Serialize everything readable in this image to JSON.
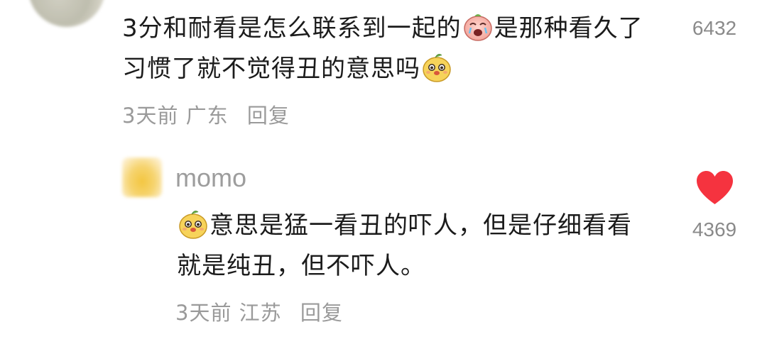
{
  "top_comment": {
    "text_part1": "3分和耐看是怎么联系到一起的",
    "emoji1": "crying-face-emoji",
    "text_part2": "是那种看久了习惯了就不觉得丑的意思吗",
    "emoji2": "smiling-mango-emoji",
    "time": "3天前",
    "location": "广东",
    "reply_label": "回复",
    "like_count": "6432",
    "like_icon": "heart-outline-icon"
  },
  "reply": {
    "username": "momo",
    "emoji": "smiling-mango-emoji",
    "text": "意思是猛一看丑的吓人，但是仔细看看就是纯丑，但不吓人。",
    "time": "3天前",
    "location": "江苏",
    "reply_label": "回复",
    "like_count": "4369",
    "like_icon": "heart-filled-icon",
    "like_color": "#f5333f"
  }
}
